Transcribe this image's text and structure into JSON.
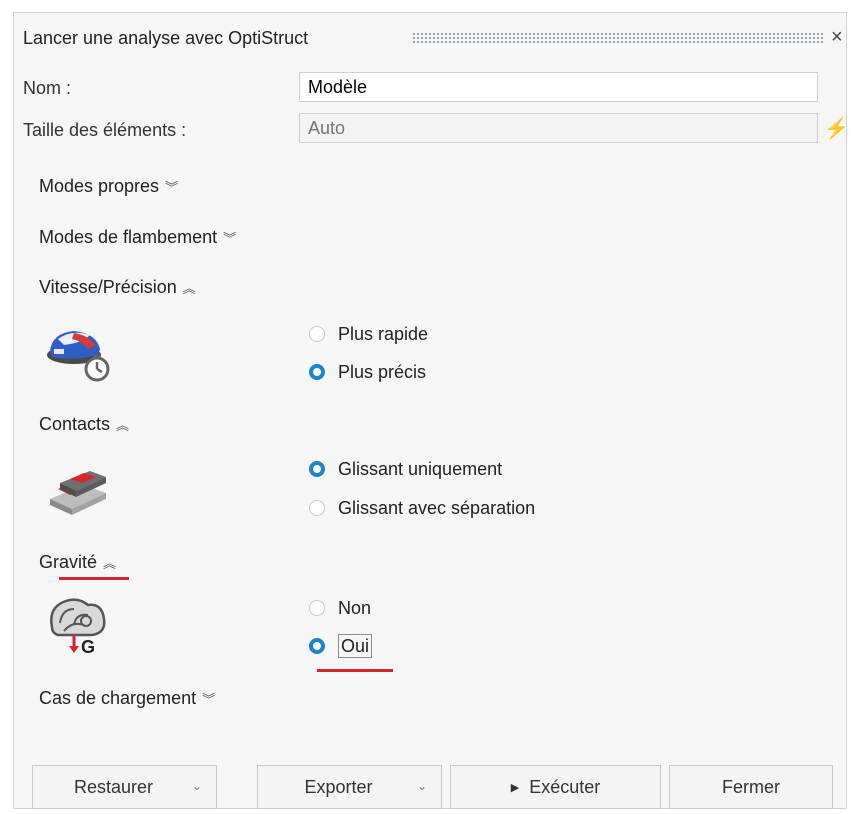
{
  "dialog": {
    "title": "Lancer une analyse avec OptiStruct",
    "close_glyph": "×"
  },
  "form": {
    "name_label": "Nom :",
    "name_value": "Modèle",
    "size_label": "Taille des éléments :",
    "size_placeholder": "Auto",
    "size_action_glyph": "⚡"
  },
  "sections": {
    "modes_propres": {
      "label": "Modes propres",
      "state": "collapsed",
      "chevron": "︾"
    },
    "modes_flambement": {
      "label": "Modes de flambement",
      "state": "collapsed",
      "chevron": "︾"
    },
    "vitesse": {
      "label": "Vitesse/Précision",
      "state": "expanded",
      "chevron": "︽",
      "icon": "speed-precision-icon",
      "options": [
        {
          "label": "Plus rapide",
          "checked": false
        },
        {
          "label": "Plus précis",
          "checked": true
        }
      ]
    },
    "contacts": {
      "label": "Contacts",
      "state": "expanded",
      "chevron": "︽",
      "icon": "contact-sliding-icon",
      "options": [
        {
          "label": "Glissant uniquement",
          "checked": true
        },
        {
          "label": "Glissant avec séparation",
          "checked": false
        }
      ]
    },
    "gravite": {
      "label": "Gravité",
      "state": "expanded",
      "chevron": "︽",
      "icon": "gravity-icon",
      "icon_letter": "G",
      "options": [
        {
          "label": "Non",
          "checked": false
        },
        {
          "label": "Oui",
          "checked": true
        }
      ]
    },
    "cas_chargement": {
      "label": "Cas de chargement",
      "state": "collapsed",
      "chevron": "︾"
    }
  },
  "buttons": {
    "restaurer": "Restaurer",
    "exporter": "Exporter",
    "executer": "Exécuter",
    "fermer": "Fermer",
    "dropdown_glyph": "⌄",
    "play_glyph": "▶"
  },
  "colors": {
    "accent": "#1b86c3",
    "annotation_red": "#d7262b"
  }
}
